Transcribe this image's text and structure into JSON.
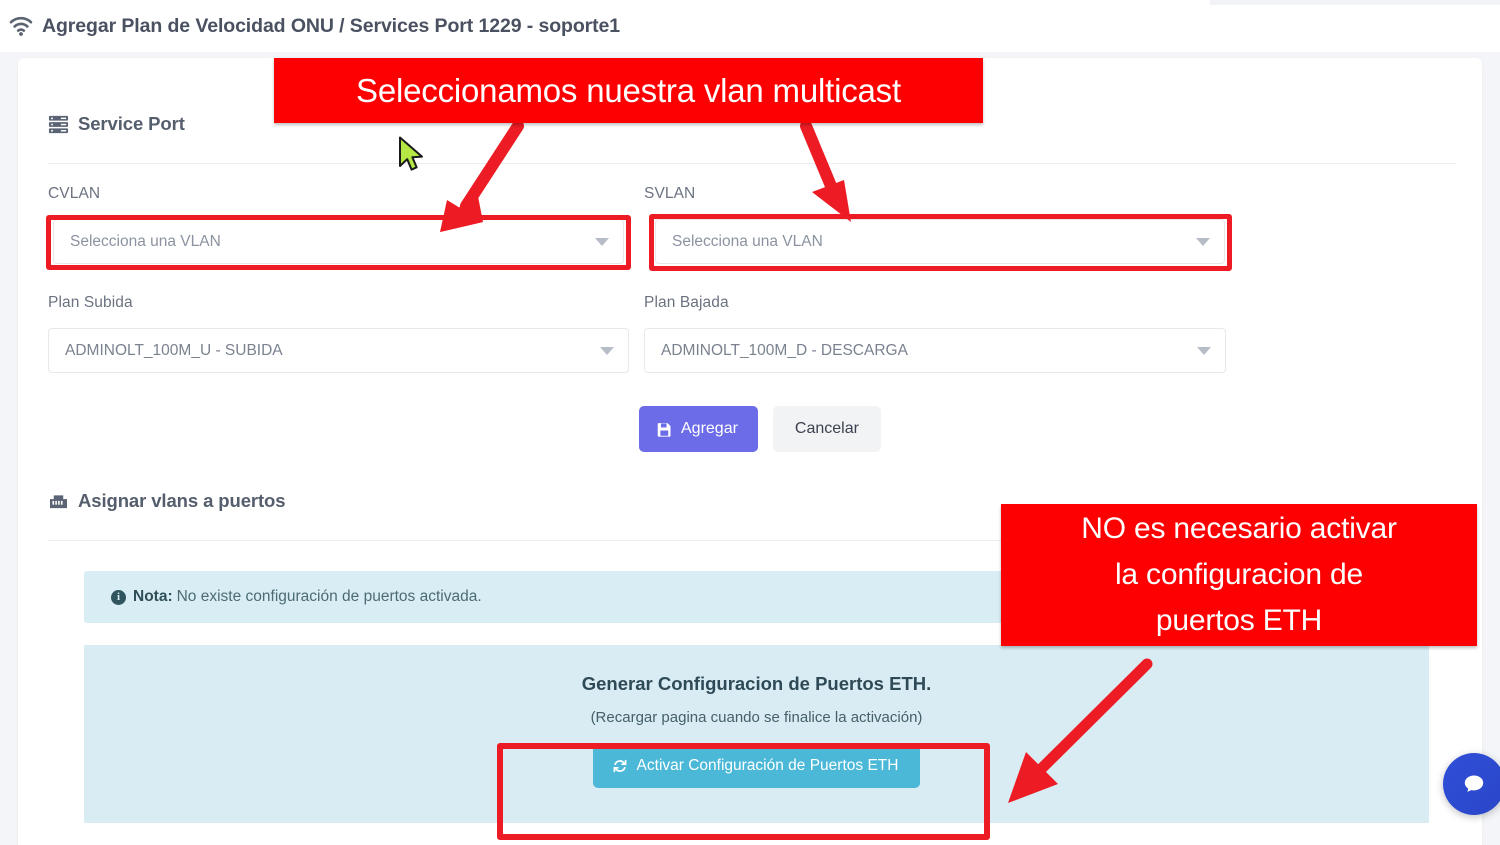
{
  "header": {
    "icon": "wifi-icon",
    "title": "Agregar Plan de Velocidad ONU / Services Port 1229 - soporte1"
  },
  "service_port": {
    "icon": "server-stack-icon",
    "title": "Service Port",
    "fields": {
      "cvlan": {
        "label": "CVLAN",
        "value": "Selecciona una VLAN",
        "placeholder": "Selecciona una VLAN",
        "is_placeholder": true
      },
      "svlan": {
        "label": "SVLAN",
        "value": "Selecciona una VLAN",
        "placeholder": "Selecciona una VLAN",
        "is_placeholder": true
      },
      "plan_subida": {
        "label": "Plan Subida",
        "value": "ADMINOLT_100M_U - SUBIDA",
        "placeholder": "Selecciona un plan",
        "is_placeholder": false
      },
      "plan_bajada": {
        "label": "Plan Bajada",
        "value": "ADMINOLT_100M_D - DESCARGA",
        "placeholder": "Selecciona un plan",
        "is_placeholder": false
      }
    },
    "buttons": {
      "submit_label": "Agregar",
      "submit_icon": "save-floppy-icon",
      "cancel_label": "Cancelar"
    }
  },
  "assign_vlans": {
    "icon": "ethernet-port-icon",
    "title": "Asignar vlans a puertos",
    "nota": {
      "icon": "info-icon",
      "strong": "Nota:",
      "text": "No existe configuración de puertos activada."
    },
    "eth_panel": {
      "title": "Generar Configuracion de Puertos ETH.",
      "subtitle": "(Recargar pagina cuando se finalice la activación)",
      "button_label": "Activar Configuración de Puertos ETH",
      "button_icon": "refresh-sync-icon"
    }
  },
  "annotations": {
    "top_banner": "Seleccionamos nuestra vlan multicast",
    "eth_banner_line1": "NO es necesario activar",
    "eth_banner_line2": "la configuracion de",
    "eth_banner_line3": "puertos ETH"
  },
  "chat": {
    "icon": "chat-bubble-icon"
  },
  "colors": {
    "annotation_red": "#fd0102",
    "highlight_red": "#ed1c24",
    "primary_button": "#6c6ce8",
    "activate_button": "#4bb8d8",
    "info_panel": "#d9ecf4",
    "chat_blue": "#2f4fd8"
  }
}
